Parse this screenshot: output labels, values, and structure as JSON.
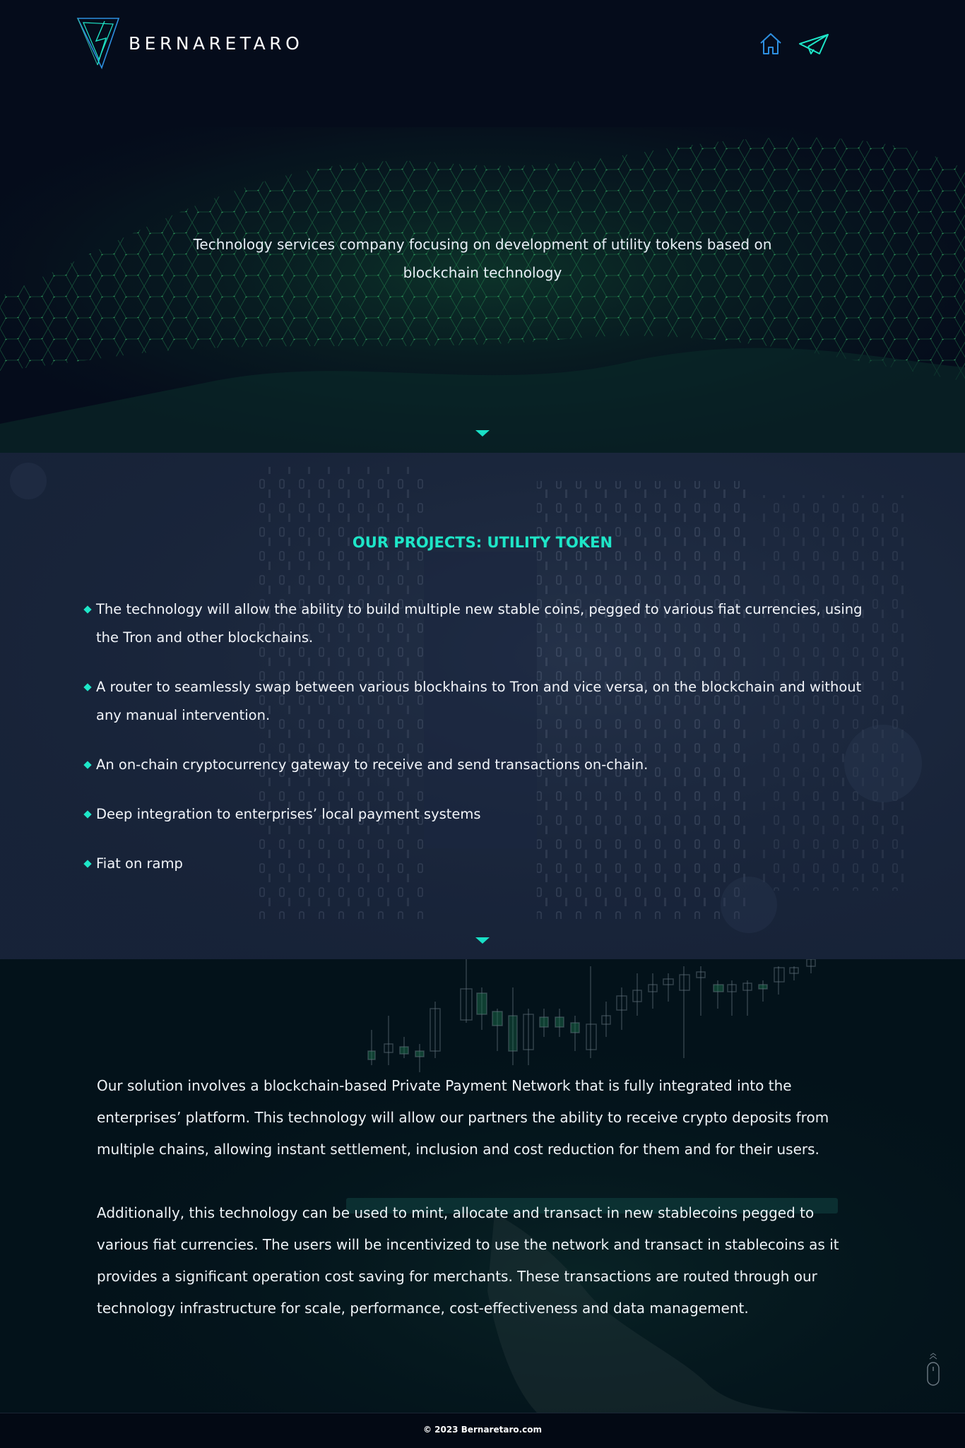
{
  "header": {
    "brand": "BERNARETARO",
    "nav": [
      {
        "icon": "home-icon"
      },
      {
        "icon": "paper-plane-icon"
      }
    ]
  },
  "hero": {
    "tagline": "Technology services company focusing on development of utility tokens based on blockchain technology"
  },
  "projects": {
    "title_prefix": "OUR PROJECTS: ",
    "title_strong": "UTILITY TOKEN",
    "items": [
      "The technology will allow the ability to build multiple new stable coins, pegged to various fiat currencies, using the Tron and other blockchains.",
      "A router to seamlessly swap between various blockhains to Tron and vice versa, on the blockchain and without any manual intervention.",
      "An on-chain cryptocurrency gateway to receive and send transactions on-chain.",
      "Deep integration to enterprises’ local payment systems",
      "Fiat on ramp"
    ]
  },
  "solution": {
    "paragraphs": [
      "Our solution involves a blockchain-based Private Payment Network that is fully integrated into the enterprises’ platform. This technology will allow our partners the ability to receive crypto deposits from multiple chains, allowing instant settlement, inclusion and cost reduction for them and for their users.",
      "Additionally, this technology can be used to mint, allocate and transact in new stablecoins pegged to various fiat currencies. The users will be incentivized to use the network and transact in stablecoins as it provides a significant operation cost saving for merchants. These transactions are routed through our technology infrastructure for scale, performance, cost-effectiveness and data management."
    ]
  },
  "footer": {
    "copyright": "© 2023 Bernaretaro.com"
  },
  "colors": {
    "accent": "#1ee6c8",
    "hero_bg": "#050c1b",
    "projects_bg": "#18243a",
    "solution_bg": "#03121a",
    "nav_icon": "#2d8fe0"
  }
}
